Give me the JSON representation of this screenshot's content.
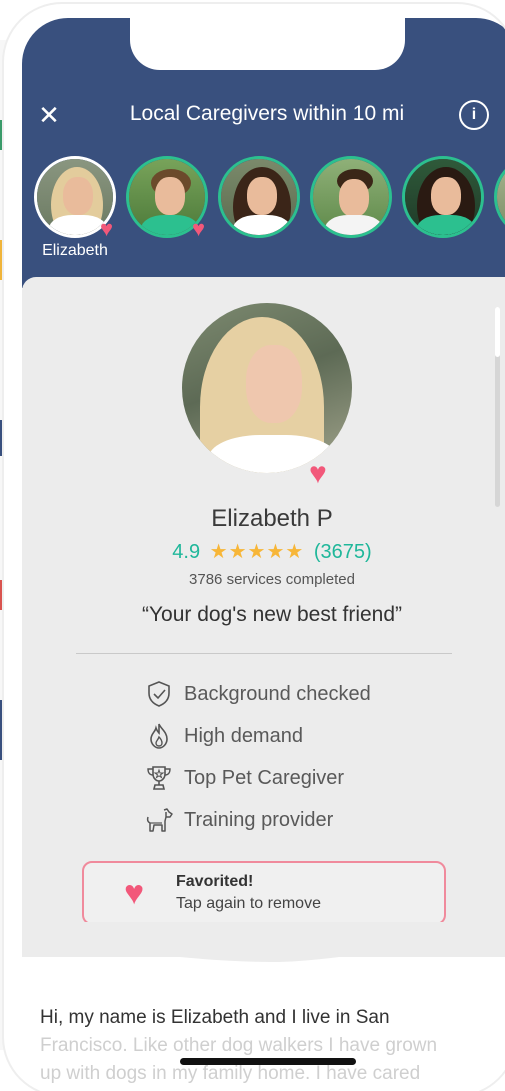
{
  "header": {
    "title": "Local Caregivers within 10 mi",
    "close_icon": "close-icon",
    "info_icon": "info-icon",
    "info_symbol": "i",
    "background": "#39507e"
  },
  "avatars": {
    "selected_name": "Elizabeth",
    "favorite_icon": "heart-icon",
    "ring_color": "#2cc08f"
  },
  "profile": {
    "name": "Elizabeth P",
    "rating": "4.9",
    "stars": "★★★★★",
    "review_count": "(3675)",
    "services": "3786 services completed",
    "tagline": "“Your dog's new best friend”",
    "heart_icon": "heart-icon"
  },
  "badges": [
    {
      "icon": "shield-check-icon",
      "label": "Background checked"
    },
    {
      "icon": "flame-icon",
      "label": "High demand"
    },
    {
      "icon": "trophy-icon",
      "label": "Top Pet Caregiver"
    },
    {
      "icon": "dog-icon",
      "label": "Training provider"
    }
  ],
  "favorite": {
    "title": "Favorited!",
    "subtitle": "Tap again to remove",
    "icon": "heart-icon",
    "accent": "#f2587a"
  },
  "bio": {
    "line1": "Hi, my name is Elizabeth and I live in San",
    "line2": "Francisco. Like other dog walkers I have grown",
    "line3": "up with dogs in my family home. I have cared"
  },
  "colors": {
    "accent_green": "#1fb79a",
    "star": "#f7b638",
    "heart": "#f2587a"
  }
}
